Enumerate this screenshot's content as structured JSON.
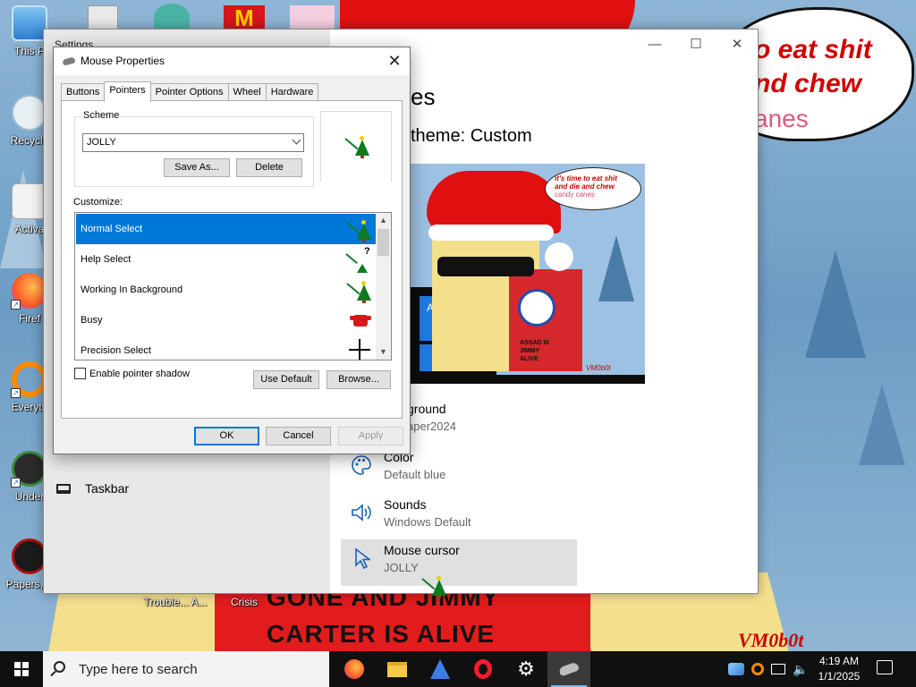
{
  "wallpaper": {
    "bubble_line1": "o eat shit",
    "bubble_line2": "nd chew",
    "bubble_line3": "anes",
    "shirt_line1": "GONE AND JIMMY",
    "shirt_line2": "CARTER IS ALIVE",
    "signature": "VM0b0t"
  },
  "desktop_icons": [
    {
      "label": "This P"
    },
    {
      "label": "Recycle"
    },
    {
      "label": "Activa"
    },
    {
      "label": "Firef"
    },
    {
      "label": "Everyth"
    },
    {
      "label": "Under"
    },
    {
      "label": "Papers, P"
    },
    {
      "label": "Trouble... A..."
    },
    {
      "label": "Crisis"
    }
  ],
  "settings": {
    "window_title": "Settings",
    "heading": "es",
    "current_theme": "theme: Custom",
    "taskbar_item": "Taskbar",
    "controls": {
      "minimize": "—",
      "maximize": "☐",
      "close": "✕"
    },
    "preview": {
      "bubble_line1": "it's time to eat shit",
      "bubble_line2": "and die and chew",
      "bubble_line3": "candy canes",
      "tile_label": "Aa",
      "shirt_text": "ASSAD IS\nJIMMY\nALIVE",
      "signature": "VM0b0t"
    },
    "items": [
      {
        "title": "ground",
        "subtitle": "aper2024",
        "icon": "picture-icon"
      },
      {
        "title": "Color",
        "subtitle": "Default blue",
        "icon": "palette-icon"
      },
      {
        "title": "Sounds",
        "subtitle": "Windows Default",
        "icon": "speaker-icon"
      },
      {
        "title": "Mouse cursor",
        "subtitle": "JOLLY",
        "icon": "cursor-icon"
      }
    ]
  },
  "mouse_properties": {
    "title": "Mouse Properties",
    "tabs": [
      "Buttons",
      "Pointers",
      "Pointer Options",
      "Wheel",
      "Hardware"
    ],
    "active_tab": "Pointers",
    "scheme_label": "Scheme",
    "scheme_value": "JOLLY",
    "save_as_label": "Save As...",
    "delete_label": "Delete",
    "customize_label": "Customize:",
    "cursors": [
      {
        "name": "Normal Select",
        "glyph": "tree-cursor",
        "selected": true
      },
      {
        "name": "Help Select",
        "glyph": "tree-help-cursor",
        "selected": false
      },
      {
        "name": "Working In Background",
        "glyph": "tree-cursor",
        "selected": false
      },
      {
        "name": "Busy",
        "glyph": "sweater-cursor",
        "selected": false
      },
      {
        "name": "Precision Select",
        "glyph": "crosshair-cursor",
        "selected": false
      }
    ],
    "help_mark": "?",
    "enable_shadow_label": "Enable pointer shadow",
    "enable_shadow_checked": false,
    "use_default_label": "Use Default",
    "browse_label": "Browse...",
    "ok_label": "OK",
    "cancel_label": "Cancel",
    "apply_label": "Apply"
  },
  "taskbar": {
    "search_placeholder": "Type here to search",
    "apps": [
      "firefox-icon",
      "file-explorer-icon",
      "bluestacks-icon",
      "opera-icon",
      "settings-gear-icon",
      "mouse-properties-icon"
    ],
    "time": "4:19 AM",
    "date": "1/1/2025"
  },
  "colors": {
    "accent": "#0078d7",
    "wallpaper_red": "#e01010",
    "wallpaper_sky": "#8fb6d6"
  }
}
